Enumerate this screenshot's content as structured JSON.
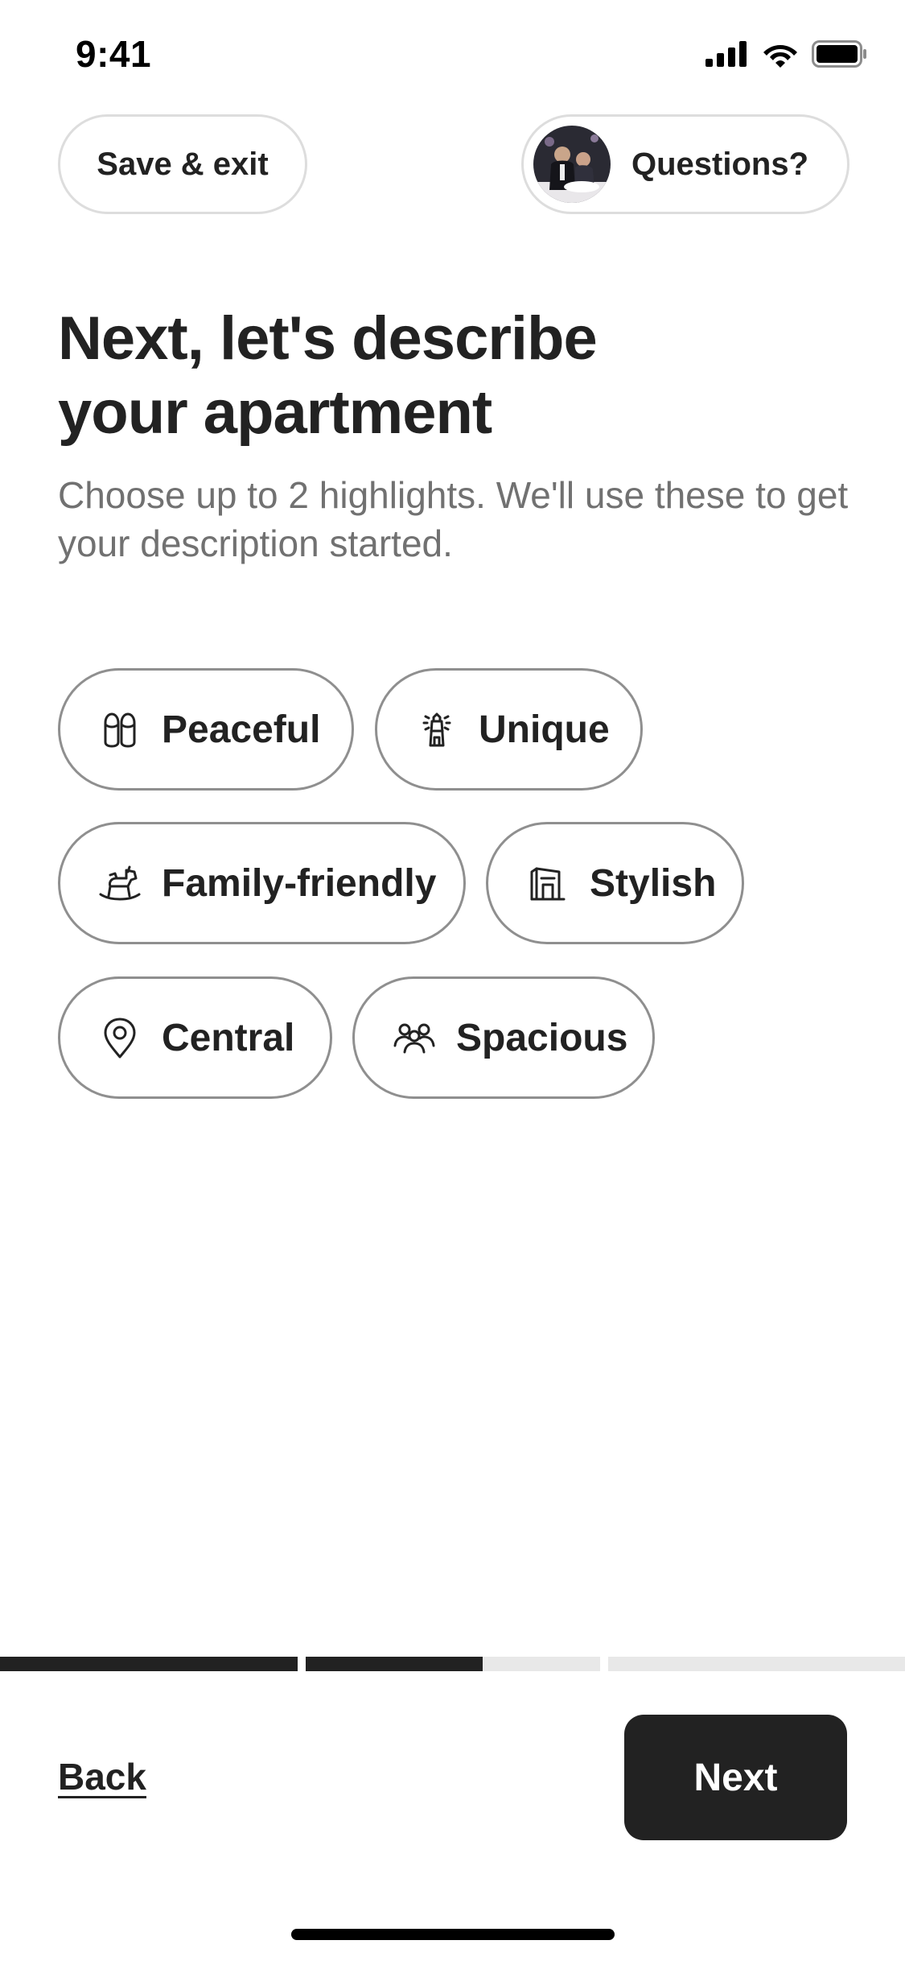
{
  "status_bar": {
    "time": "9:41"
  },
  "header": {
    "save_exit_label": "Save & exit",
    "questions_label": "Questions?"
  },
  "main": {
    "title_line1": "Next, let's describe",
    "title_line2": "your apartment",
    "subtitle": "Choose up to 2 highlights. We'll use these to get your description started."
  },
  "highlights": [
    {
      "label": "Peaceful",
      "icon": "slippers-icon",
      "selected": false
    },
    {
      "label": "Unique",
      "icon": "lighthouse-icon",
      "selected": false
    },
    {
      "label": "Family-friendly",
      "icon": "rocking-horse-icon",
      "selected": false
    },
    {
      "label": "Stylish",
      "icon": "building-icon",
      "selected": false
    },
    {
      "label": "Central",
      "icon": "map-pin-icon",
      "selected": false
    },
    {
      "label": "Spacious",
      "icon": "people-icon",
      "selected": false
    }
  ],
  "progress": {
    "segments": [
      1.0,
      0.6,
      0.0
    ]
  },
  "footer": {
    "back_label": "Back",
    "next_label": "Next"
  },
  "colors": {
    "primary": "#222222",
    "muted_text": "#717171",
    "chip_border": "#8f8f8f",
    "progress_track": "#e8e8e8"
  }
}
